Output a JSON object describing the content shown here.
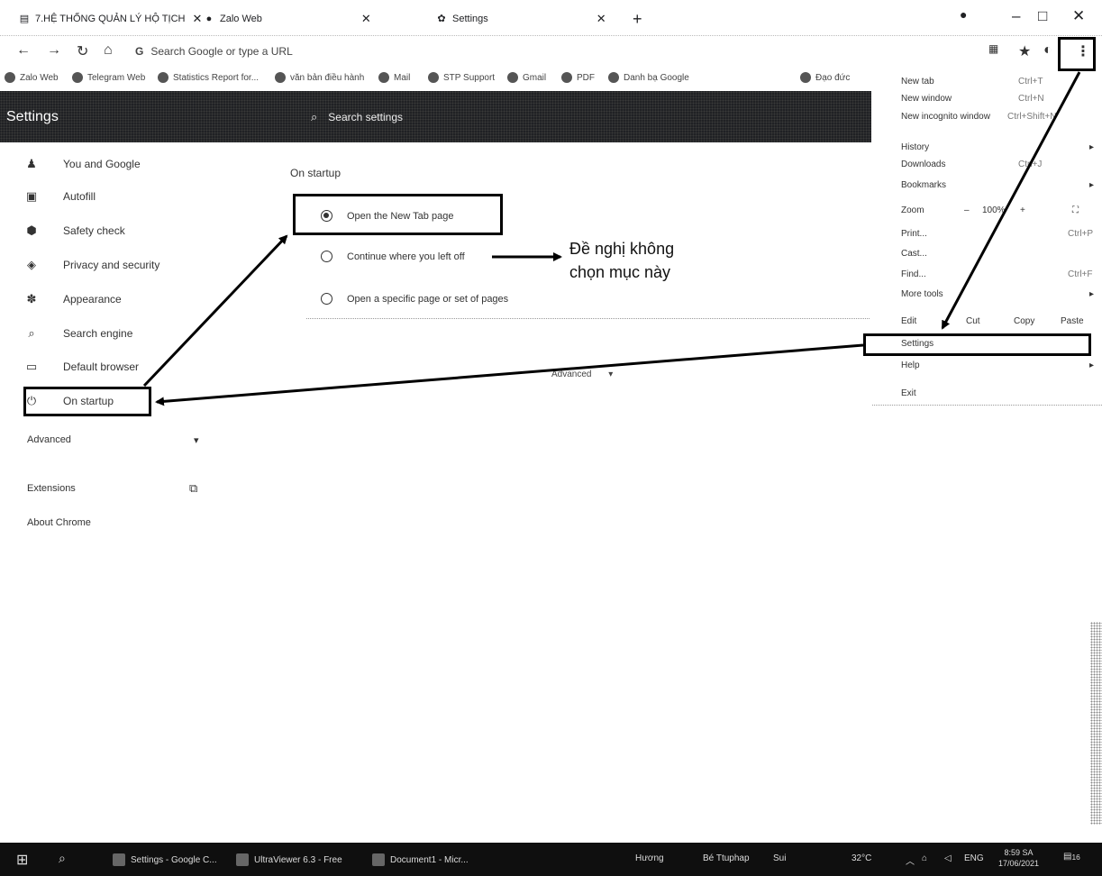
{
  "tabs": [
    {
      "title": "7.HỆ THỐNG QUẢN LÝ HỘ TỊCH",
      "icon": "doc-icon"
    },
    {
      "title": "Zalo Web",
      "icon": "zalo-icon"
    },
    {
      "title": "Settings",
      "icon": "gear-icon"
    }
  ],
  "window_controls": {
    "minimize": "–",
    "maximize": "□",
    "close": "✕"
  },
  "omnibox": {
    "placeholder": "Search Google or type a URL"
  },
  "bookmarks": [
    "Zalo Web",
    "Telegram Web",
    "Statistics Report for...",
    "văn bản điều hành",
    "Mail",
    "STP Support",
    "Gmail",
    "PDF",
    "Danh bạ Google",
    "Đạo đức"
  ],
  "header": {
    "title": "Settings",
    "search_placeholder": "Search settings"
  },
  "sidebar": {
    "items": [
      {
        "label": "You and Google",
        "icon": "person-icon"
      },
      {
        "label": "Autofill",
        "icon": "clipboard-icon"
      },
      {
        "label": "Safety check",
        "icon": "shield-check-icon"
      },
      {
        "label": "Privacy and security",
        "icon": "shield-icon"
      },
      {
        "label": "Appearance",
        "icon": "palette-icon"
      },
      {
        "label": "Search engine",
        "icon": "search-icon"
      },
      {
        "label": "Default browser",
        "icon": "browser-icon"
      },
      {
        "label": "On startup",
        "icon": "power-icon"
      }
    ],
    "advanced": "Advanced",
    "extensions": "Extensions",
    "about": "About Chrome"
  },
  "main": {
    "section_title": "On startup",
    "options": [
      {
        "label": "Open the New Tab page",
        "selected": true
      },
      {
        "label": "Continue where you left off",
        "selected": false
      },
      {
        "label": "Open a specific page or set of pages",
        "selected": false
      }
    ],
    "advanced": "Advanced"
  },
  "annotation": {
    "line1": "Đề nghị không",
    "line2": "chọn mục này"
  },
  "menu": {
    "new_tab": "New tab",
    "new_tab_sc": "Ctrl+T",
    "new_window": "New window",
    "new_window_sc": "Ctrl+N",
    "incognito": "New incognito window",
    "incognito_sc": "Ctrl+Shift+N",
    "history": "History",
    "downloads": "Downloads",
    "downloads_sc": "Ctrl+J",
    "bookmarks": "Bookmarks",
    "zoom": "Zoom",
    "zoom_minus": "–",
    "zoom_value": "100%",
    "zoom_plus": "+",
    "print": "Print...",
    "print_sc": "Ctrl+P",
    "cast": "Cast...",
    "find": "Find...",
    "find_sc": "Ctrl+F",
    "more_tools": "More tools",
    "edit": "Edit",
    "cut": "Cut",
    "copy": "Copy",
    "paste": "Paste",
    "settings": "Settings",
    "help": "Help",
    "exit": "Exit"
  },
  "taskbar": {
    "items": [
      "Settings - Google C...",
      "UltraViewer 6.3 - Free",
      "Document1 - Micr..."
    ],
    "tray": [
      "Hương",
      "Bé Ttuphap",
      "Sui"
    ],
    "temperature": "32°C",
    "language": "ENG",
    "time": "8:59 SA",
    "date": "17/06/2021",
    "notifications": "16"
  }
}
